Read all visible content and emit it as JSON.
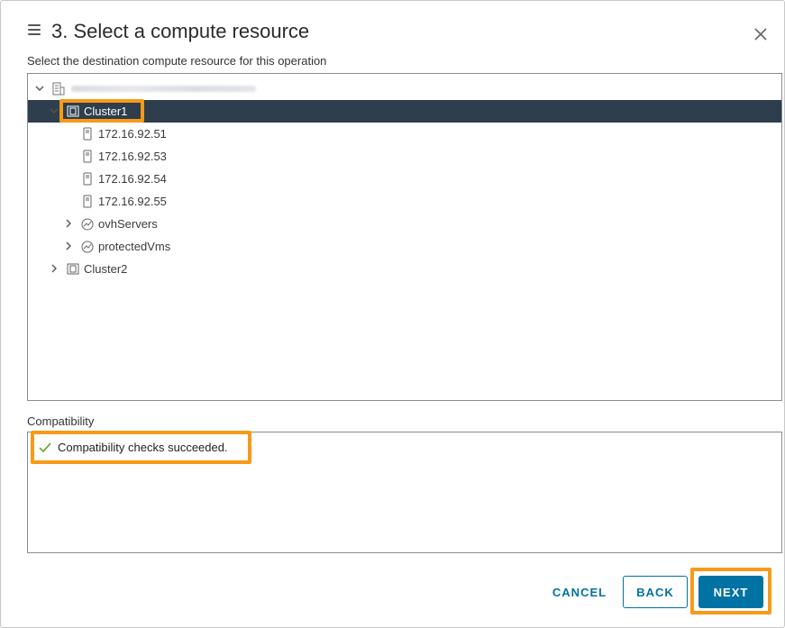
{
  "dialog": {
    "title": "3. Select a compute resource",
    "subtitle": "Select the destination compute resource for this operation"
  },
  "tree": {
    "rows": [
      {
        "label": "",
        "icon": "datacenter-icon",
        "expanded": true
      },
      {
        "label": "Cluster1",
        "icon": "cluster-icon",
        "expanded": true,
        "selected": true
      },
      {
        "label": "172.16.92.51",
        "icon": "host-icon"
      },
      {
        "label": "172.16.92.53",
        "icon": "host-icon"
      },
      {
        "label": "172.16.92.54",
        "icon": "host-icon"
      },
      {
        "label": "172.16.92.55",
        "icon": "host-icon"
      },
      {
        "label": "ovhServers",
        "icon": "resource-pool-icon",
        "expanded": false
      },
      {
        "label": "protectedVms",
        "icon": "resource-pool-icon",
        "expanded": false
      },
      {
        "label": "Cluster2",
        "icon": "cluster-icon",
        "expanded": false
      }
    ]
  },
  "compatibility": {
    "label": "Compatibility",
    "message": "Compatibility checks succeeded.",
    "status_color": "#5aa220"
  },
  "footer": {
    "cancel_label": "CANCEL",
    "back_label": "BACK",
    "next_label": "NEXT"
  },
  "colors": {
    "accent": "#0072a3",
    "selected_row": "#2e3e4c",
    "highlight": "#f79a17"
  }
}
